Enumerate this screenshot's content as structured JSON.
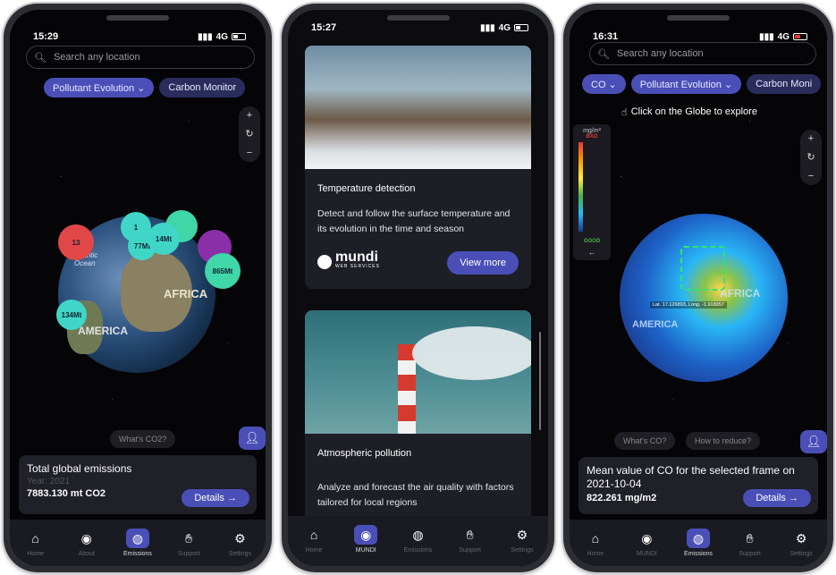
{
  "phones": [
    {
      "time": "15:29",
      "network": "4G",
      "search_placeholder": "Search any location",
      "chips": [
        "Pollutant Evolution ⌄",
        "Carbon Monitor"
      ],
      "bubbles": [
        "1",
        "77Mt",
        "14Mt",
        "865Mt",
        "134Mt",
        "13"
      ],
      "globe_labels": [
        "Atlantic Ocean",
        "AFRICA",
        "AMERICA"
      ],
      "faq": "What's CO2?",
      "card": {
        "title": "Total global emissions",
        "year": "Year: 2021",
        "value": "7883.130 mt CO2",
        "button": "Details →"
      },
      "nav": [
        "Home",
        "About",
        "Emissions",
        "Support",
        "Settings"
      ],
      "active_nav": "Emissions"
    },
    {
      "time": "15:27",
      "network": "4G",
      "card1": {
        "title": "Temperature detection",
        "desc": "Detect and follow the surface temperature and its evolution in the time and season",
        "logo": "mundi",
        "logo_sub": "WEB SERVICES",
        "button": "View more"
      },
      "card2": {
        "title": "Atmospheric pollution",
        "desc": "Analyze and forecast the air quality with factors tailored for local regions"
      },
      "nav": [
        "Home",
        "MUNDI",
        "Emissions",
        "Support",
        "Settings"
      ],
      "active_nav": "MUNDI"
    },
    {
      "time": "16:31",
      "network": "4G",
      "search_placeholder": "Search any location",
      "chips": [
        "CO ⌄",
        "Pollutant Evolution ⌄",
        "Carbon Moni"
      ],
      "hint": "Click on the Globe to explore",
      "legend_unit": "mg/m²",
      "legend_top": "BAD",
      "legend_bottom": "GOOD",
      "coords": "Lat. 17.126893, Long. -1.918957",
      "globe_labels": [
        "AFRICA",
        "AMERICA"
      ],
      "faq": [
        "What's CO?",
        "How to reduce?"
      ],
      "card": {
        "title": "Mean value of CO for the selected frame on 2021-10-04",
        "value": "822.261 mg/m2",
        "button": "Details →"
      },
      "nav": [
        "Home",
        "MUNDI",
        "Emissions",
        "Support",
        "Settings"
      ],
      "active_nav": "Emissions"
    }
  ],
  "colors": {
    "accent": "#4a4fb8",
    "background": "#050507",
    "card": "#1f2028"
  }
}
